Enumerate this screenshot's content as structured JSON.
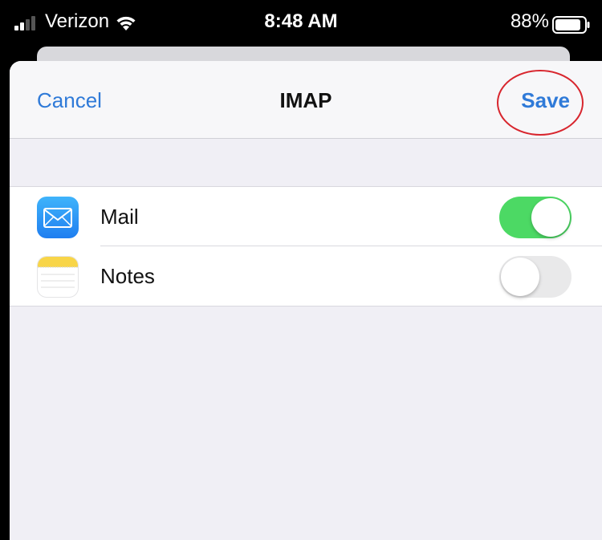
{
  "status_bar": {
    "carrier": "Verizon",
    "time": "8:48 AM",
    "battery_percent": "88%"
  },
  "nav": {
    "cancel_label": "Cancel",
    "title": "IMAP",
    "save_label": "Save"
  },
  "rows": [
    {
      "label": "Mail",
      "icon": "mail-app-icon",
      "enabled": true
    },
    {
      "label": "Notes",
      "icon": "notes-app-icon",
      "enabled": false
    }
  ],
  "colors": {
    "accent": "#2f7ad8",
    "toggle_on": "#4cd964",
    "toggle_off": "#e9e9ea",
    "highlight_circle": "#d8262e",
    "background": "#f0eff5"
  }
}
